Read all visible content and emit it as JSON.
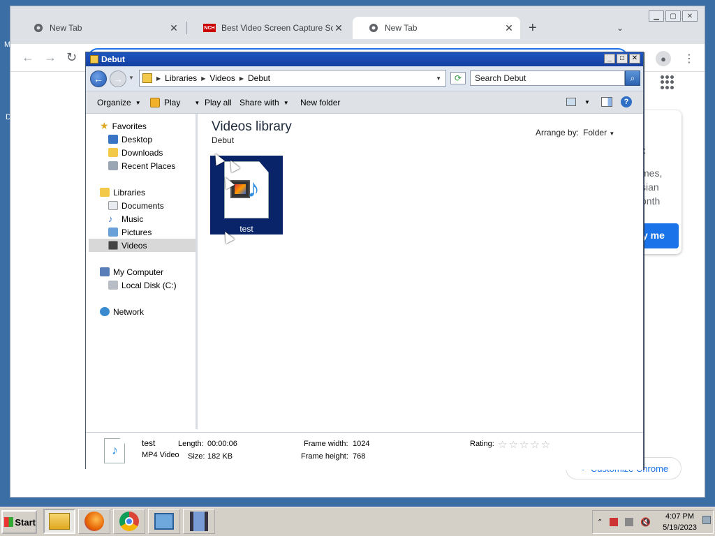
{
  "chrome": {
    "tabs": [
      {
        "title": "New Tab",
        "active": false
      },
      {
        "title": "Best Video Screen Capture Softw",
        "active": false
      },
      {
        "title": "New Tab",
        "active": true
      }
    ],
    "card": {
      "heading_fragment": "t",
      "text_fragment_1": "mes,",
      "text_fragment_2": "sian",
      "text_fragment_3": "onth",
      "button_fragment": "y me"
    },
    "customize_label": "Customize Chrome",
    "accent_color": "#1a73e8"
  },
  "explorer": {
    "title": "Debut",
    "breadcrumb": [
      "Libraries",
      "Videos",
      "Debut"
    ],
    "search_placeholder": "Search Debut",
    "commands": {
      "organize": "Organize",
      "play": "Play",
      "play_all": "Play all",
      "share_with": "Share with",
      "new_folder": "New folder"
    },
    "nav": {
      "favorites": {
        "label": "Favorites",
        "items": [
          "Desktop",
          "Downloads",
          "Recent Places"
        ]
      },
      "libraries": {
        "label": "Libraries",
        "items": [
          "Documents",
          "Music",
          "Pictures",
          "Videos"
        ]
      },
      "computer": {
        "label": "My Computer",
        "items": [
          "Local Disk (C:)"
        ]
      },
      "network": {
        "label": "Network"
      },
      "selected": "Videos"
    },
    "library": {
      "title": "Videos library",
      "subtitle": "Debut",
      "arrange_label": "Arrange by:",
      "arrange_value": "Folder"
    },
    "files": [
      {
        "name": "test",
        "selected": true,
        "icon": "video-file-icon"
      }
    ],
    "details": {
      "name": "test",
      "type": "MP4 Video",
      "length_label": "Length:",
      "length": "00:00:06",
      "size_label": "Size:",
      "size": "182 KB",
      "frame_width_label": "Frame width:",
      "frame_width": "1024",
      "frame_height_label": "Frame height:",
      "frame_height": "768",
      "rating_label": "Rating:",
      "rating": 0,
      "rating_max": 5
    },
    "selection_color": "#0a246a"
  },
  "taskbar": {
    "start_label": "Start",
    "apps": [
      "explorer-icon",
      "firefox-icon",
      "chrome-icon",
      "control-panel-icon",
      "debut-icon"
    ],
    "clock_time": "4:07 PM",
    "clock_date": "5/19/2023"
  }
}
